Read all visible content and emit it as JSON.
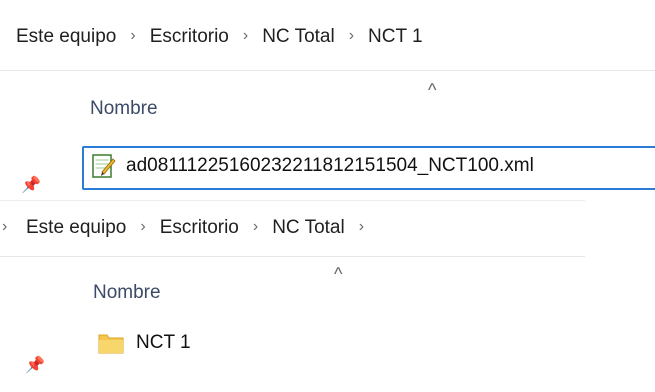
{
  "top_window": {
    "breadcrumb": [
      "Este equipo",
      "Escritorio",
      "NC Total",
      "NCT 1"
    ],
    "column_header": "Nombre",
    "file": {
      "name": "ad08111225160232211812151504_NCT100.xml",
      "icon": "xml-file-icon"
    }
  },
  "bottom_window": {
    "breadcrumb": [
      "Este equipo",
      "Escritorio",
      "NC Total"
    ],
    "column_header": "Nombre",
    "folder": {
      "name": "NCT 1",
      "icon": "folder-icon"
    }
  },
  "icons": {
    "separator": "chevron-right-icon",
    "sort": "sort-ascending-caret-icon",
    "pin": "pin-icon"
  },
  "colors": {
    "selection_border": "#2a7cd6",
    "folder_yellow": "#f4c64d",
    "header_text": "#3b4a66"
  }
}
